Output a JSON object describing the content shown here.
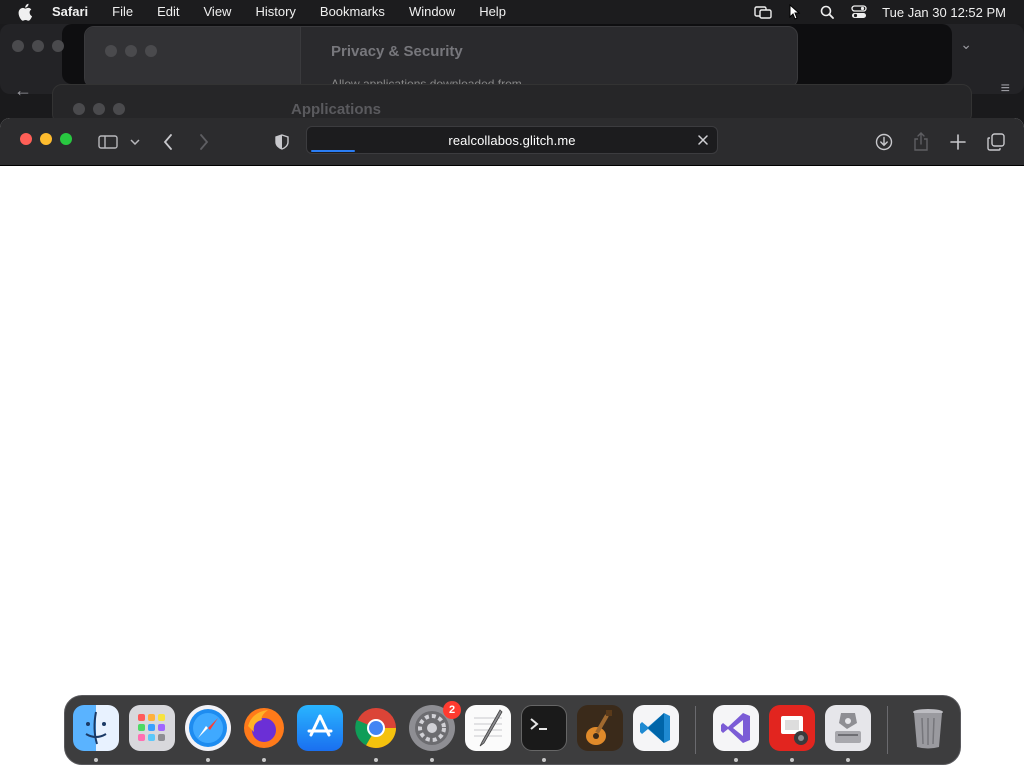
{
  "menubar": {
    "app_name": "Safari",
    "items": [
      "File",
      "Edit",
      "View",
      "History",
      "Bookmarks",
      "Window",
      "Help"
    ],
    "clock": "Tue Jan 30  12:52 PM"
  },
  "background_windows": {
    "settings_title": "Privacy & Security",
    "settings_subtitle": "Allow applications downloaded from",
    "finder_title": "Applications"
  },
  "safari": {
    "url": "realcollabos.glitch.me",
    "load_progress": 0.11
  },
  "dock": {
    "apps": [
      {
        "name": "Finder",
        "icon": "finder-icon",
        "running": true
      },
      {
        "name": "Launchpad",
        "icon": "launchpad-icon",
        "running": false
      },
      {
        "name": "Safari",
        "icon": "safari-icon",
        "running": true
      },
      {
        "name": "Firefox",
        "icon": "firefox-icon",
        "running": true
      },
      {
        "name": "App Store",
        "icon": "app-store-icon",
        "running": false
      },
      {
        "name": "Google Chrome",
        "icon": "chrome-icon",
        "running": true
      },
      {
        "name": "System Settings",
        "icon": "system-settings-icon",
        "running": true,
        "badge": "2"
      },
      {
        "name": "TextEdit",
        "icon": "textedit-icon",
        "running": false
      },
      {
        "name": "Terminal",
        "icon": "terminal-icon",
        "running": true
      },
      {
        "name": "GarageBand",
        "icon": "garageband-icon",
        "running": false
      },
      {
        "name": "Visual Studio Code",
        "icon": "vscode-icon",
        "running": false
      },
      {
        "name": "Visual Studio",
        "icon": "visual-studio-icon",
        "running": true
      },
      {
        "name": "Photo Booth",
        "icon": "photo-app-icon",
        "running": true
      },
      {
        "name": "Disk Utility",
        "icon": "disk-utility-icon",
        "running": true
      },
      {
        "name": "Trash",
        "icon": "trash-icon",
        "running": false
      }
    ]
  }
}
